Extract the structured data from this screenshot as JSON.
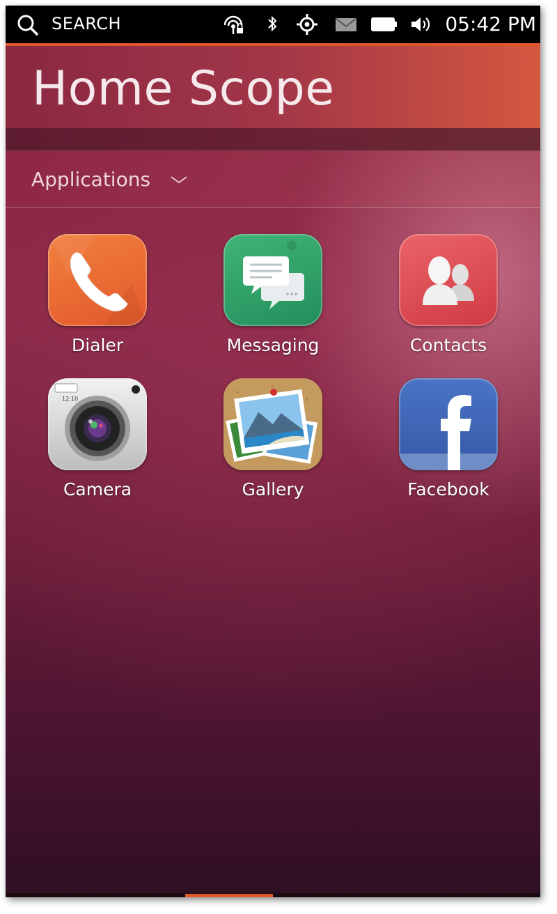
{
  "statusbar": {
    "search_label": "SEARCH",
    "time": "05:42 PM",
    "icons": [
      "search-icon",
      "network-locked-icon",
      "bluetooth-icon",
      "location-icon",
      "messages-icon",
      "battery-icon",
      "volume-icon"
    ]
  },
  "header": {
    "title": "Home Scope"
  },
  "category": {
    "label": "Applications"
  },
  "apps": [
    {
      "label": "Dialer",
      "icon": "dialer-icon",
      "color": "#e8642c"
    },
    {
      "label": "Messaging",
      "icon": "messaging-icon",
      "color": "#2e9e66"
    },
    {
      "label": "Contacts",
      "icon": "contacts-icon",
      "color": "#dc4a52"
    },
    {
      "label": "Camera",
      "icon": "camera-icon",
      "color": "#cfcfcf"
    },
    {
      "label": "Gallery",
      "icon": "gallery-icon",
      "color": "#b88a52"
    },
    {
      "label": "Facebook",
      "icon": "facebook-icon",
      "color": "#3b62b4"
    }
  ],
  "camera_tile_text": "12:10",
  "colors": {
    "accent": "#e0582a",
    "background": "#8a2440"
  }
}
